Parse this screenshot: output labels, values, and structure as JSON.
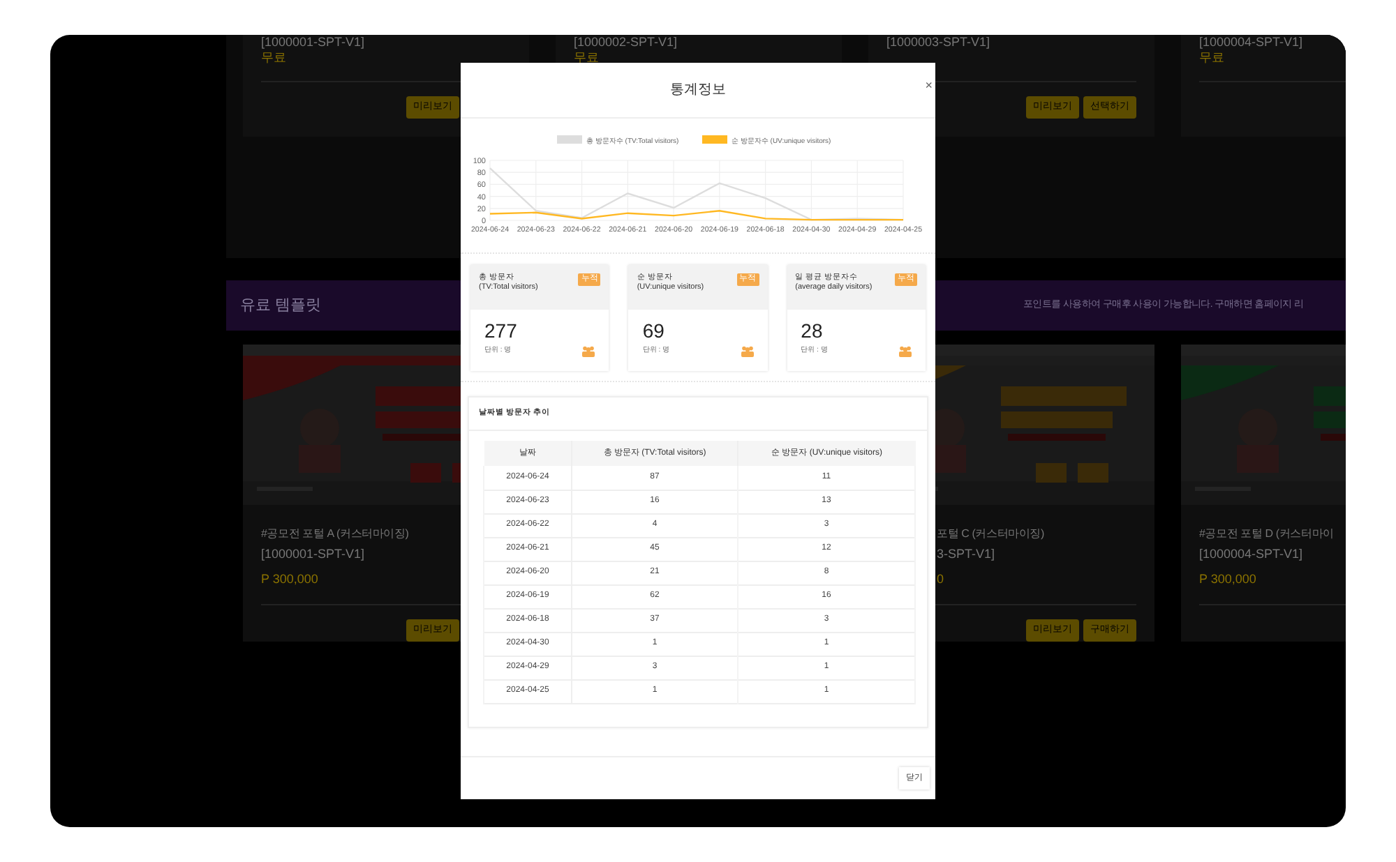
{
  "background": {
    "top_cards": [
      {
        "code": "[1000001-SPT-V1]",
        "price": "무료",
        "buttons": [
          "미리보기"
        ]
      },
      {
        "code": "[1000002-SPT-V1]",
        "price": "무료"
      },
      {
        "code": "[1000003-SPT-V1]",
        "buttons": [
          "미리보기",
          "선택하기"
        ]
      },
      {
        "code": "[1000004-SPT-V1]",
        "price": "무료"
      }
    ],
    "banner": {
      "title": "유료 템플릿",
      "notice": "포인트를 사용하여 구매후 사용이 가능합니다. 구매하면 홈페이지 리"
    },
    "cards": [
      {
        "kind": "card",
        "title": "#공모전 포털 A (커스터마이징)",
        "code": "[1000001-SPT-V1]",
        "price": "P 300,000",
        "buttons": [
          "미리보기"
        ]
      },
      {
        "kind": "covered"
      },
      {
        "kind": "card",
        "title": "포털 C (커스터마이징)",
        "code": "3-SPT-V1]",
        "price": "0",
        "buttons": [
          "미리보기",
          "구매하기"
        ]
      },
      {
        "kind": "card",
        "title": "#공모전 포털 D (커스터마이",
        "code": "[1000004-SPT-V1]",
        "price": "P 300,000"
      }
    ]
  },
  "modal": {
    "title": "통계정보",
    "close": "×",
    "chart_data": {
      "type": "line",
      "categories": [
        "2024-06-24",
        "2024-06-23",
        "2024-06-22",
        "2024-06-21",
        "2024-06-20",
        "2024-06-19",
        "2024-06-18",
        "2024-04-30",
        "2024-04-29",
        "2024-04-25"
      ],
      "series": [
        {
          "name": "총 방문자수 (TV:Total visitors)",
          "color": "#dddddd",
          "values": [
            87,
            16,
            4,
            45,
            21,
            62,
            37,
            1,
            3,
            1
          ]
        },
        {
          "name": "순 방문자수 (UV:unique visitors)",
          "color": "#ffb822",
          "values": [
            11,
            13,
            3,
            12,
            8,
            16,
            3,
            1,
            1,
            1
          ]
        }
      ],
      "ylim": [
        0,
        100
      ],
      "yticks": [
        0,
        20,
        40,
        60,
        80,
        100
      ],
      "grid": true,
      "legend": true
    },
    "stats": [
      {
        "title": "총 방문자",
        "subtitle": "(TV:Total visitors)",
        "badge": "누적",
        "value": "277",
        "unit": "단위 : 명"
      },
      {
        "title": "순 방문자",
        "subtitle": "(UV:unique visitors)",
        "badge": "누적",
        "value": "69",
        "unit": "단위 : 명"
      },
      {
        "title": "일 평균 방문자수",
        "subtitle": "(average daily visitors)",
        "badge": "누적",
        "value": "28",
        "unit": "단위 : 명"
      }
    ],
    "table": {
      "title": "날짜별 방문자 추이",
      "columns": [
        "날짜",
        "총 방문자 (TV:Total visitors)",
        "순 방문자 (UV:unique visitors)"
      ],
      "rows": [
        [
          "2024-06-24",
          "87",
          "11"
        ],
        [
          "2024-06-23",
          "16",
          "13"
        ],
        [
          "2024-06-22",
          "4",
          "3"
        ],
        [
          "2024-06-21",
          "45",
          "12"
        ],
        [
          "2024-06-20",
          "21",
          "8"
        ],
        [
          "2024-06-19",
          "62",
          "16"
        ],
        [
          "2024-06-18",
          "37",
          "3"
        ],
        [
          "2024-04-30",
          "1",
          "1"
        ],
        [
          "2024-04-29",
          "3",
          "1"
        ],
        [
          "2024-04-25",
          "1",
          "1"
        ]
      ]
    },
    "footer_button": "닫기"
  }
}
